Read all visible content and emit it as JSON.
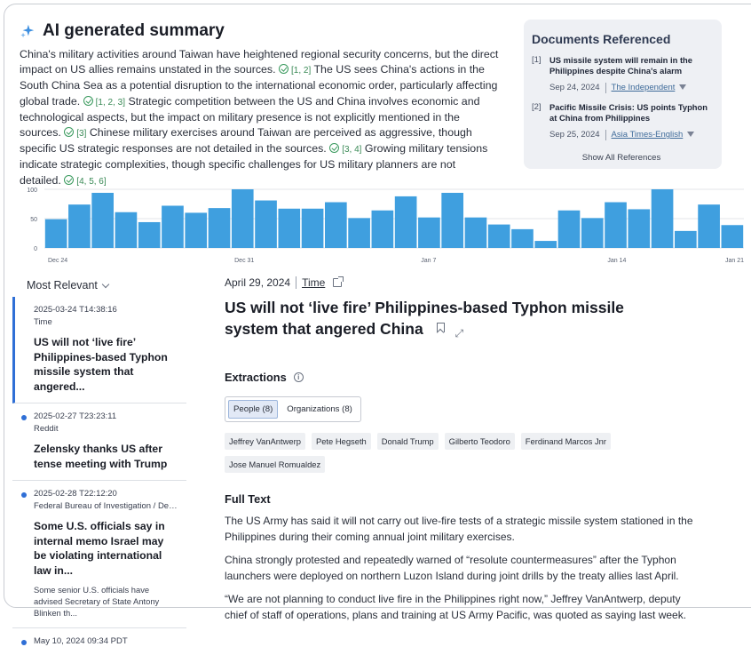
{
  "summary": {
    "title": "AI generated summary",
    "segments": [
      {
        "text": "China's military activities around Taiwan have heightened regional security concerns, but the direct impact on US allies remains unstated in the sources. ",
        "cite": "[1, 2]"
      },
      {
        "text": " The US sees China's actions in the South China Sea as a potential disruption to the international economic order, particularly affecting global trade. ",
        "cite": "[1, 2, 3]"
      },
      {
        "text": " Strategic competition between the US and China involves economic and technological aspects, but the impact on military presence is not explicitly mentioned in the sources. ",
        "cite": "[3]"
      },
      {
        "text": " Chinese military exercises around Taiwan are perceived as aggressive, though specific US strategic responses are not detailed in the sources. ",
        "cite": "[3, 4]"
      },
      {
        "text": " Growing military tensions indicate strategic complexities, though specific challenges for US military planners are not detailed. ",
        "cite": "[4, 5, 6]"
      }
    ]
  },
  "docs": {
    "title": "Documents Referenced",
    "items": [
      {
        "num": "[1]",
        "title": "US missile system will remain in the Philippines despite China's alarm",
        "date": "Sep 24, 2024",
        "source": "The Independent"
      },
      {
        "num": "[2]",
        "title": "Pacific Missile Crisis: US points Typhon at China from Philippines",
        "date": "Sep 25, 2024",
        "source": "Asia Times-English"
      }
    ],
    "show_all": "Show All References"
  },
  "chart_data": {
    "type": "bar",
    "yticks": [
      "100",
      "50",
      "0"
    ],
    "ylim": [
      0,
      100
    ],
    "xtick_labels": [
      {
        "label": "Dec 24",
        "index": 0
      },
      {
        "label": "Dec 31",
        "index": 8
      },
      {
        "label": "Jan 7",
        "index": 16
      },
      {
        "label": "Jan 14",
        "index": 24
      },
      {
        "label": "Jan 21",
        "index": 32
      }
    ],
    "values": [
      49,
      74,
      94,
      61,
      44,
      72,
      60,
      68,
      100,
      81,
      67,
      67,
      78,
      51,
      64,
      88,
      52,
      94,
      52,
      40,
      32,
      12,
      64,
      51,
      78,
      66,
      100,
      29,
      74,
      39
    ],
    "color": "#3f9fdf"
  },
  "list": {
    "sort_label": "Most Relevant",
    "items": [
      {
        "date": "2025-03-24 T14:38:16",
        "source": "Time",
        "title": "US will not ‘live fire’ Philippines-based Typhon missile system that angered...",
        "snippet": ""
      },
      {
        "date": "2025-02-27 T23:23:11",
        "source": "Reddit",
        "title": "Zelensky thanks US after tense meeting with Trump",
        "snippet": ""
      },
      {
        "date": "2025-02-28 T22:12:20",
        "source": "Federal Bureau of Investigation / Dep...",
        "title": "Some U.S. officials say in internal memo Israel may be violating international law in...",
        "snippet": "Some senior U.S. officials have advised Secretary of State Antony Blinken th..."
      },
      {
        "date": "May 10, 2024 09:34 PDT",
        "source": "",
        "title": "",
        "snippet": ""
      }
    ]
  },
  "article": {
    "date": "April 29, 2024",
    "source": "Time",
    "title": "US will not ‘live fire’ Philippines-based Typhon missile system that angered China",
    "extractions_label": "Extractions",
    "tabs": [
      "People (8)",
      "Organizations (8)"
    ],
    "people": [
      "Jeffrey VanAntwerp",
      "Pete Hegseth",
      "Donald Trump",
      "Gilberto Teodoro",
      "Ferdinand Marcos Jnr",
      "Jose Manuel Romualdez"
    ],
    "fulltext_label": "Full Text",
    "paragraphs": [
      "The US Army has said it will not carry out live-fire tests of a strategic missile system stationed in the Philippines during their coming annual joint military exercises.",
      "China strongly protested and repeatedly warned of “resolute countermeasures” after the Typhon launchers were deployed on northern Luzon Island during joint drills by the treaty allies last April.",
      "“We are not planning to conduct live fire in the Philippines right now,” Jeffrey VanAntwerp, deputy chief of staff of operations, plans and training at US Army Pacific, was quoted as saying last week."
    ]
  }
}
